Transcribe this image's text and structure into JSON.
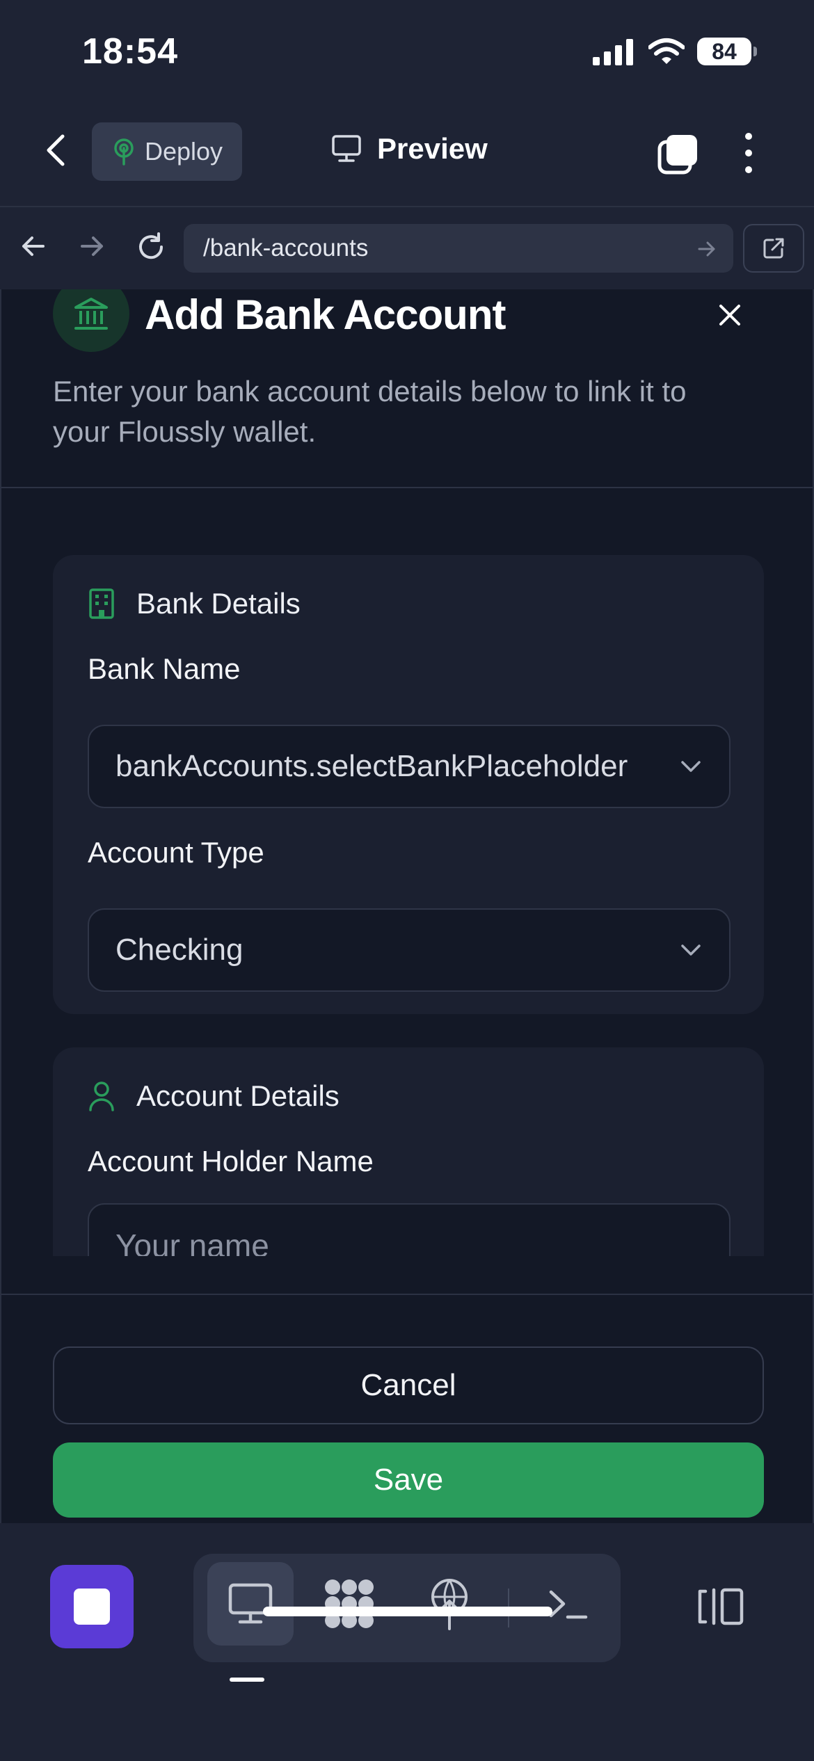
{
  "status_bar": {
    "time": "18:54",
    "battery": "84"
  },
  "toolbar": {
    "deploy_label": "Deploy",
    "preview_label": "Preview"
  },
  "browser": {
    "url": "/bank-accounts"
  },
  "modal": {
    "title": "Add Bank Account",
    "description": "Enter your bank account details below to link it to your Floussly wallet.",
    "bank_section": {
      "heading": "Bank Details",
      "bank_name_label": "Bank Name",
      "bank_name_value": "bankAccounts.selectBankPlaceholder",
      "account_type_label": "Account Type",
      "account_type_value": "Checking"
    },
    "account_section": {
      "heading": "Account Details",
      "holder_label": "Account Holder Name",
      "holder_placeholder": "Your name"
    },
    "cancel_label": "Cancel",
    "save_label": "Save"
  },
  "colors": {
    "accent_green": "#2a9d5c",
    "stop_purple": "#5b3bd6",
    "background": "#1e2334",
    "modal": "#131826"
  }
}
